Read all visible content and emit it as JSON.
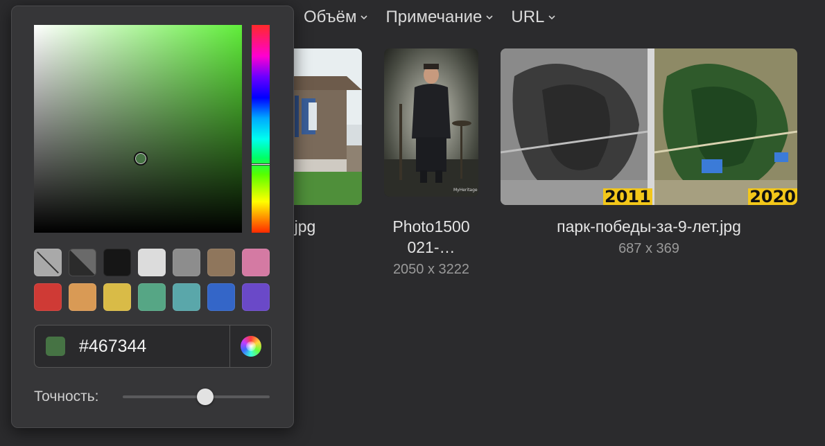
{
  "filters": [
    {
      "label": "Объём"
    },
    {
      "label": "Примечание"
    },
    {
      "label": "URL"
    }
  ],
  "gallery": [
    {
      "caption_line1": "jpg",
      "caption_line2": "",
      "dims": ""
    },
    {
      "caption_line1": "Photo1500",
      "caption_line2": "021-…",
      "dims": "2050 x 3222"
    },
    {
      "caption_line1": "парк-победы-за-9-лет.jpg",
      "caption_line2": "",
      "dims": "687 x 369",
      "badges": [
        "2011",
        "2020"
      ]
    }
  ],
  "picker": {
    "hex_value": "#467344",
    "current_color": "#467344",
    "precision_label": "Точность:",
    "precision_value": 0.56,
    "hue_level": 0.67,
    "swatches": [
      {
        "name": "none",
        "color": "#a9a9a9"
      },
      {
        "name": "transparent-dark",
        "color": "#3c3c3c"
      },
      {
        "name": "black",
        "color": "#161616"
      },
      {
        "name": "light-gray",
        "color": "#dcdcdc"
      },
      {
        "name": "gray",
        "color": "#8d8d8d"
      },
      {
        "name": "brown",
        "color": "#8f765c"
      },
      {
        "name": "pink",
        "color": "#d47aa3"
      },
      {
        "name": "red",
        "color": "#cf3a35"
      },
      {
        "name": "orange",
        "color": "#d99a55"
      },
      {
        "name": "yellow",
        "color": "#d9bb47"
      },
      {
        "name": "green",
        "color": "#56a685"
      },
      {
        "name": "teal",
        "color": "#5aa7aa"
      },
      {
        "name": "blue",
        "color": "#3466c8"
      },
      {
        "name": "purple",
        "color": "#6a49c8"
      }
    ]
  }
}
